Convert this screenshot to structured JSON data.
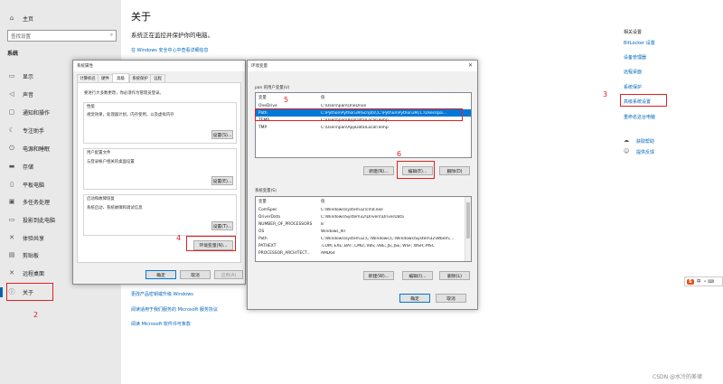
{
  "sidebar": {
    "home": "主页",
    "search_placeholder": "查找设置",
    "search_icon": "search-icon",
    "section_title": "系统",
    "items": [
      {
        "label": "显示",
        "icon": "monitor-icon"
      },
      {
        "label": "声音",
        "icon": "speaker-icon"
      },
      {
        "label": "通知和操作",
        "icon": "notification-icon"
      },
      {
        "label": "专注助手",
        "icon": "moon-icon"
      },
      {
        "label": "电源和睡眠",
        "icon": "power-icon"
      },
      {
        "label": "存储",
        "icon": "storage-icon"
      },
      {
        "label": "平板电脑",
        "icon": "tablet-icon"
      },
      {
        "label": "多任务处理",
        "icon": "multitask-icon"
      },
      {
        "label": "投影到此电脑",
        "icon": "projector-icon"
      },
      {
        "label": "体验共享",
        "icon": "share-icon"
      },
      {
        "label": "剪贴板",
        "icon": "clipboard-icon"
      },
      {
        "label": "远程桌面",
        "icon": "remote-icon"
      },
      {
        "label": "关于",
        "icon": "info-icon"
      }
    ]
  },
  "main": {
    "title": "关于",
    "subtitle": "系统正在监控并保护你的电脑。",
    "security_link": "在 Windows 安全中心中查看详细信息",
    "bottom_links": [
      "更改产品密钥或升级 Windows",
      "阅读适用于我们服务的 Microsoft 服务协议",
      "阅读 Microsoft 软件许可条款"
    ]
  },
  "related": {
    "title": "相关设置",
    "links": [
      "BitLocker 设置",
      "设备管理器",
      "远程桌面",
      "系统保护",
      "高级系统设置",
      "重命名这台电脑"
    ],
    "help": "获取帮助",
    "feedback": "提供反馈"
  },
  "sysprops": {
    "title": "系统属性",
    "tabs": [
      "计算机名",
      "硬件",
      "高级",
      "系统保护",
      "远程"
    ],
    "intro": "要进行大多数更改，你必须作为管理员登录。",
    "perf_title": "性能",
    "perf_desc": "视觉效果，处理器计划，内存使用，以及虚拟内存",
    "profile_title": "用户配置文件",
    "profile_desc": "与登录帐户相关的桌面设置",
    "startup_title": "启动和故障恢复",
    "startup_desc": "系统启动、系统故障和调试信息",
    "settings_btn": "设置(S)...",
    "settings_btn2": "设置(E)...",
    "settings_btn3": "设置(T)...",
    "env_btn": "环境变量(N)...",
    "ok": "确定",
    "cancel": "取消",
    "apply": "应用(A)"
  },
  "envvars": {
    "title": "环境变量",
    "user_group": "pan 的用户变量(U)",
    "col_var": "变量",
    "col_val": "值",
    "user_rows": [
      {
        "name": "OneDrive",
        "value": "C:\\Users\\pan\\OneDrive"
      },
      {
        "name": "Path",
        "value": "C:\\Python\\Python39\\Scripts\\;C:\\Python\\Python39\\;C:\\Users\\pa..."
      },
      {
        "name": "TEMP",
        "value": "C:\\Users\\pan\\AppData\\Local\\Temp"
      },
      {
        "name": "TMP",
        "value": "C:\\Users\\pan\\AppData\\Local\\Temp"
      }
    ],
    "new_btn": "新建(N)...",
    "edit_btn": "编辑(E)...",
    "delete_btn": "删除(D)",
    "sys_group": "系统变量(S)",
    "sys_rows": [
      {
        "name": "ComSpec",
        "value": "C:\\Windows\\system32\\cmd.exe"
      },
      {
        "name": "DriverData",
        "value": "C:\\Windows\\System32\\Drivers\\DriverData"
      },
      {
        "name": "NUMBER_OF_PROCESSORS",
        "value": "8"
      },
      {
        "name": "OS",
        "value": "Windows_NT"
      },
      {
        "name": "Path",
        "value": "C:\\Windows\\system32;C:\\Windows;C:\\Windows\\System32\\Wbem;..."
      },
      {
        "name": "PATHEXT",
        "value": ".COM;.EXE;.BAT;.CMD;.VBS;.VBE;.JS;.JSE;.WSF;.WSH;.MSC"
      },
      {
        "name": "PROCESSOR_ARCHITECT...",
        "value": "AMD64"
      }
    ],
    "new_btn2": "新建(W)...",
    "edit_btn2": "编辑(I)...",
    "delete_btn2": "删除(L)",
    "ok": "确定",
    "cancel": "取消"
  },
  "annotations": {
    "n2": "2",
    "n3": "3",
    "n4": "4",
    "n5": "5",
    "n6": "6"
  },
  "ime": {
    "badge": "S",
    "text": "中"
  },
  "watermark": "CSDN @水冷的差律"
}
